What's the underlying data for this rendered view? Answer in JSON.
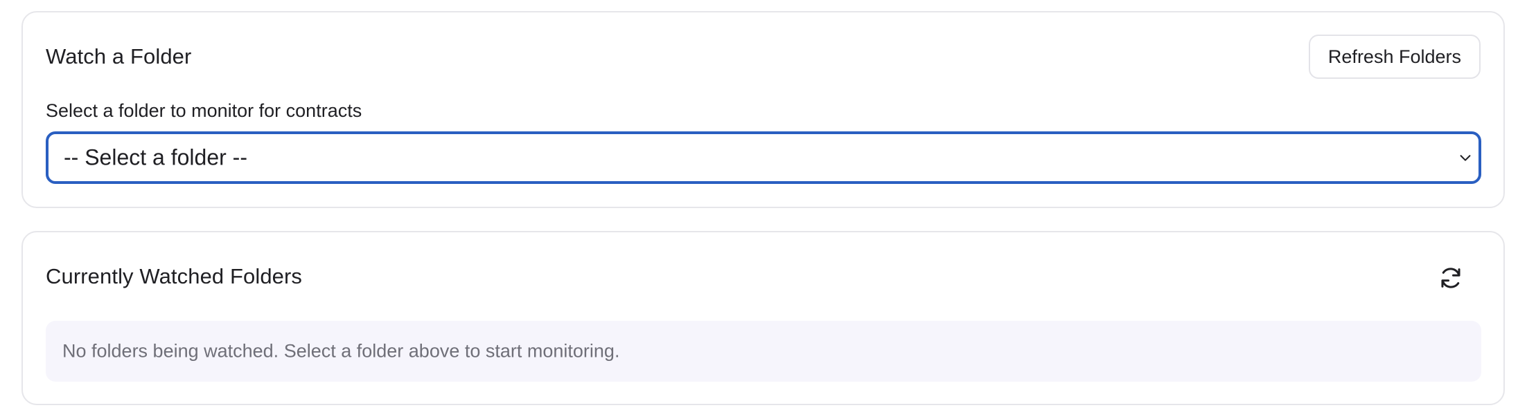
{
  "watch_card": {
    "title": "Watch a Folder",
    "refresh_button_label": "Refresh Folders",
    "field_label": "Select a folder to monitor for contracts",
    "select_value": "-- Select a folder --",
    "select_icon": "chevron-down-icon",
    "focus_color": "#2a5fc1"
  },
  "watched_card": {
    "title": "Currently Watched Folders",
    "refresh_icon": "sync-icon",
    "empty_message": "No folders being watched. Select a folder above to start monitoring.",
    "empty_bg_color": "#f6f5fc"
  }
}
